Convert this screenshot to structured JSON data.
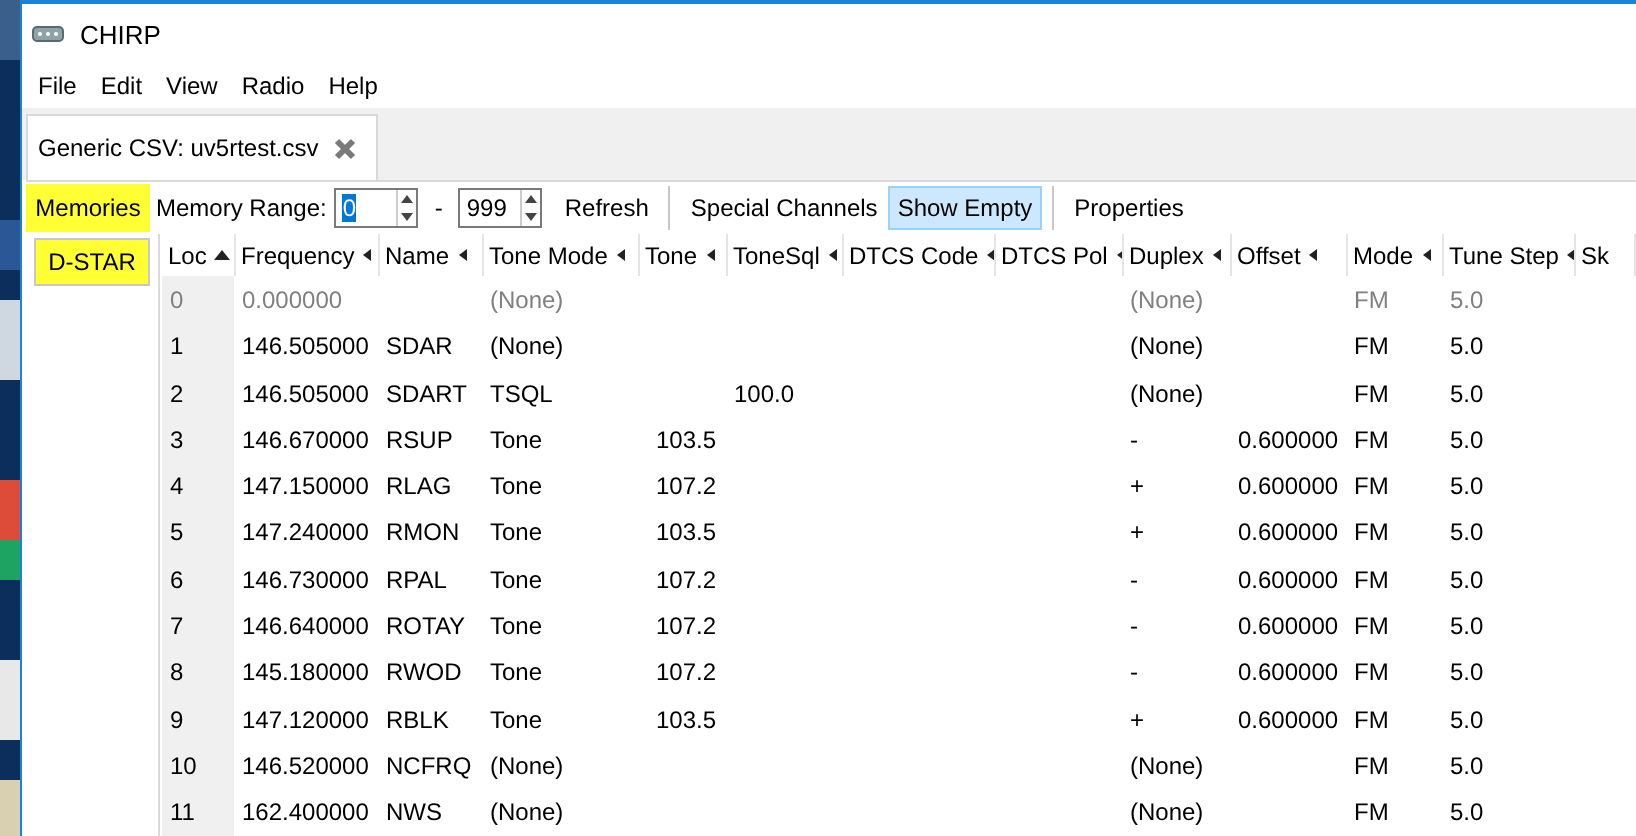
{
  "window": {
    "title": "CHIRP"
  },
  "menu": [
    "File",
    "Edit",
    "View",
    "Radio",
    "Help"
  ],
  "tabs": [
    {
      "label": "Generic CSV: uv5rtest.csv",
      "selected": true
    }
  ],
  "side_tabs": [
    {
      "label": "Memories",
      "selected": true,
      "highlighted": true
    },
    {
      "label": "D-STAR",
      "selected": false,
      "highlighted": true
    }
  ],
  "toolbar": {
    "range_label": "Memory Range:",
    "range_from": "0",
    "range_sep": "-",
    "range_to": "999",
    "buttons": [
      {
        "label": "Refresh",
        "pressed": false,
        "separator_before": false
      },
      {
        "label": "Special Channels",
        "pressed": false,
        "separator_before": true
      },
      {
        "label": "Show Empty",
        "pressed": true,
        "separator_before": false
      },
      {
        "label": "Properties",
        "pressed": false,
        "separator_before": true
      }
    ]
  },
  "table": {
    "columns": [
      {
        "label": "Loc",
        "sorted": true
      },
      {
        "label": "Frequency",
        "sorted": false
      },
      {
        "label": "Name",
        "sorted": false
      },
      {
        "label": "Tone Mode",
        "sorted": false
      },
      {
        "label": "Tone",
        "sorted": false
      },
      {
        "label": "ToneSql",
        "sorted": false
      },
      {
        "label": "DTCS Code",
        "sorted": false
      },
      {
        "label": "DTCS Pol",
        "sorted": false
      },
      {
        "label": "Duplex",
        "sorted": false
      },
      {
        "label": "Offset",
        "sorted": false
      },
      {
        "label": "Mode",
        "sorted": false
      },
      {
        "label": "Tune Step",
        "sorted": false
      },
      {
        "label": "Sk"
      }
    ],
    "rows": [
      {
        "empty": true,
        "cells": [
          "0",
          "0.000000",
          null,
          "(None)",
          null,
          null,
          null,
          null,
          "(None)",
          null,
          "FM",
          "5.0"
        ]
      },
      {
        "empty": false,
        "cells": [
          "1",
          "146.505000",
          "SDAR",
          "(None)",
          null,
          null,
          null,
          null,
          "(None)",
          null,
          "FM",
          "5.0"
        ]
      },
      {
        "empty": false,
        "cells": [
          "2",
          "146.505000",
          "SDART",
          "TSQL",
          null,
          "100.0",
          null,
          null,
          "(None)",
          null,
          "FM",
          "5.0"
        ]
      },
      {
        "empty": false,
        "cells": [
          "3",
          "146.670000",
          "RSUP",
          "Tone",
          "103.5",
          null,
          null,
          null,
          "-",
          "0.600000",
          "FM",
          "5.0"
        ]
      },
      {
        "empty": false,
        "cells": [
          "4",
          "147.150000",
          "RLAG",
          "Tone",
          "107.2",
          null,
          null,
          null,
          "+",
          "0.600000",
          "FM",
          "5.0"
        ]
      },
      {
        "empty": false,
        "cells": [
          "5",
          "147.240000",
          "RMON",
          "Tone",
          "103.5",
          null,
          null,
          null,
          "+",
          "0.600000",
          "FM",
          "5.0"
        ]
      },
      {
        "empty": false,
        "cells": [
          "6",
          "146.730000",
          "RPAL",
          "Tone",
          "107.2",
          null,
          null,
          null,
          "-",
          "0.600000",
          "FM",
          "5.0"
        ]
      },
      {
        "empty": false,
        "cells": [
          "7",
          "146.640000",
          "ROTAY",
          "Tone",
          "107.2",
          null,
          null,
          null,
          "-",
          "0.600000",
          "FM",
          "5.0"
        ]
      },
      {
        "empty": false,
        "cells": [
          "8",
          "145.180000",
          "RWOD",
          "Tone",
          "107.2",
          null,
          null,
          null,
          "-",
          "0.600000",
          "FM",
          "5.0"
        ]
      },
      {
        "empty": false,
        "cells": [
          "9",
          "147.120000",
          "RBLK",
          "Tone",
          "103.5",
          null,
          null,
          null,
          "+",
          "0.600000",
          "FM",
          "5.0"
        ]
      },
      {
        "empty": false,
        "cells": [
          "10",
          "146.520000",
          "NCFRQ",
          "(None)",
          null,
          null,
          null,
          null,
          "(None)",
          null,
          "FM",
          "5.0"
        ]
      },
      {
        "empty": false,
        "cells": [
          "11",
          "162.400000",
          "NWS",
          "(None)",
          null,
          null,
          null,
          null,
          "(None)",
          null,
          "FM",
          "5.0"
        ]
      }
    ]
  }
}
